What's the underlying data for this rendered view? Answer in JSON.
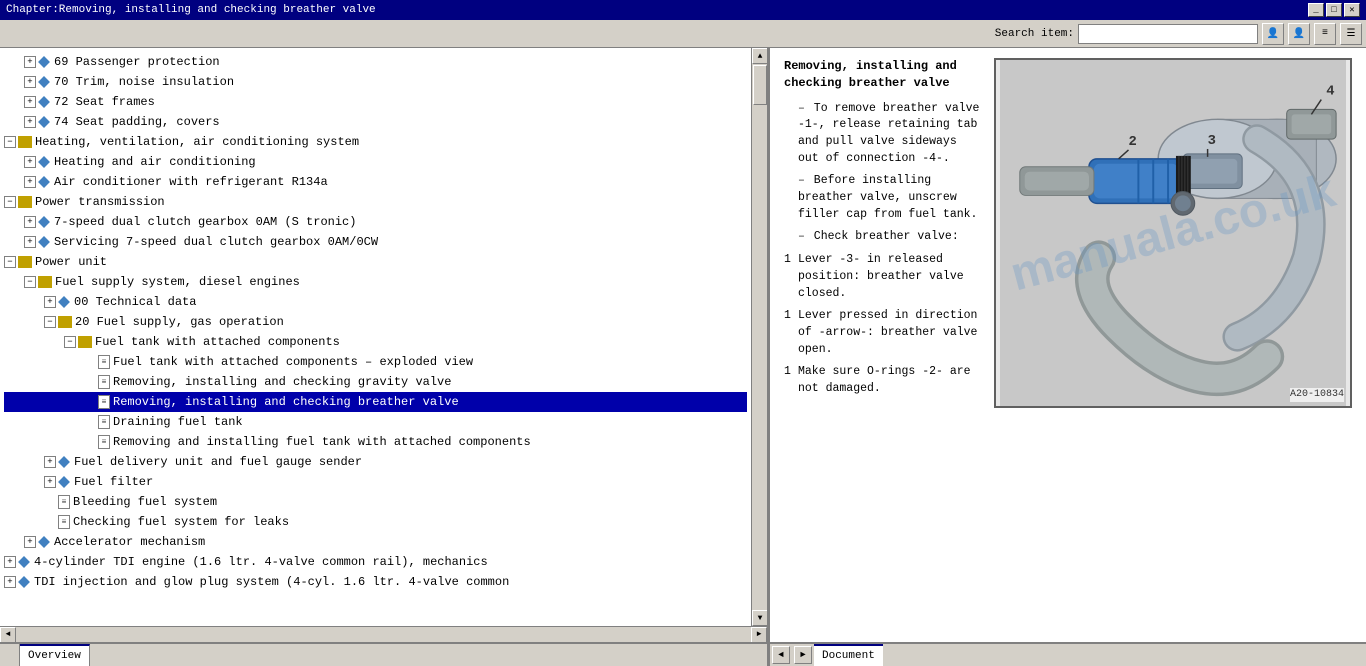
{
  "title_bar": {
    "text": "Chapter:Removing, installing and checking breather valve"
  },
  "toolbar": {
    "search_label": "Search item:",
    "search_placeholder": ""
  },
  "toolbar_buttons": [
    {
      "id": "user1",
      "label": "👤"
    },
    {
      "id": "user2",
      "label": "👤"
    },
    {
      "id": "menu1",
      "label": "≡"
    },
    {
      "id": "menu2",
      "label": "☰"
    }
  ],
  "tree": {
    "items": [
      {
        "level": 1,
        "type": "folder-expand",
        "text": "69  Passenger protection"
      },
      {
        "level": 1,
        "type": "folder-expand",
        "text": "70  Trim, noise insulation"
      },
      {
        "level": 1,
        "type": "folder-expand",
        "text": "72  Seat frames"
      },
      {
        "level": 1,
        "type": "folder-expand",
        "text": "74  Seat padding, covers"
      },
      {
        "level": 0,
        "type": "book-expand",
        "text": "Heating, ventilation, air conditioning system"
      },
      {
        "level": 1,
        "type": "diamond-expand",
        "text": "Heating and air conditioning"
      },
      {
        "level": 1,
        "type": "diamond-expand",
        "text": "Air conditioner with refrigerant R134a"
      },
      {
        "level": 0,
        "type": "book-expand",
        "text": "Power transmission"
      },
      {
        "level": 1,
        "type": "diamond-expand",
        "text": "7-speed dual clutch gearbox 0AM (S tronic)"
      },
      {
        "level": 1,
        "type": "diamond-expand",
        "text": "Servicing 7-speed dual clutch gearbox 0AM/0CW"
      },
      {
        "level": 0,
        "type": "book-expand",
        "text": "Power unit"
      },
      {
        "level": 1,
        "type": "book-expand",
        "text": "Fuel supply system, diesel engines"
      },
      {
        "level": 2,
        "type": "diamond-expand",
        "text": "00  Technical data"
      },
      {
        "level": 2,
        "type": "book-expand",
        "text": "20  Fuel supply, gas operation"
      },
      {
        "level": 3,
        "type": "book-expand",
        "text": "Fuel tank with attached components"
      },
      {
        "level": 4,
        "type": "doc",
        "text": "Fuel tank with attached components – exploded view"
      },
      {
        "level": 4,
        "type": "doc",
        "text": "Removing, installing and checking gravity valve"
      },
      {
        "level": 4,
        "type": "doc",
        "text": "Removing, installing and checking breather valve",
        "selected": true
      },
      {
        "level": 4,
        "type": "doc",
        "text": "Draining fuel tank"
      },
      {
        "level": 4,
        "type": "doc",
        "text": "Removing and installing fuel tank with attached components"
      },
      {
        "level": 2,
        "type": "diamond-expand",
        "text": "Fuel delivery unit and fuel gauge sender"
      },
      {
        "level": 2,
        "type": "diamond-expand",
        "text": "Fuel filter"
      },
      {
        "level": 2,
        "type": "doc",
        "text": "Bleeding fuel system"
      },
      {
        "level": 2,
        "type": "doc",
        "text": "Checking fuel system for leaks"
      },
      {
        "level": 1,
        "type": "diamond-expand",
        "text": "Accelerator mechanism"
      },
      {
        "level": 0,
        "type": "diamond-expand",
        "text": "4-cylinder TDI engine (1.6 ltr. 4-valve common rail), mechanics"
      },
      {
        "level": 0,
        "type": "diamond-expand",
        "text": "TDI injection and glow plug system (4-cyl. 1.6 ltr. 4-valve common"
      }
    ]
  },
  "document": {
    "title": "Removing, installing and\nchecking breather valve",
    "paragraphs": [
      {
        "num": "",
        "bullet": true,
        "text": "To remove breather valve -1-, release retaining tab and pull valve sideways out of connection -4-."
      },
      {
        "num": "",
        "bullet": true,
        "text": "Before installing breather valve, unscrew filler cap from fuel tank."
      },
      {
        "num": "",
        "bullet": true,
        "text": "Check breather valve:"
      },
      {
        "num": "1",
        "bullet": false,
        "text": "Lever -3- in released position: breather valve closed."
      },
      {
        "num": "1",
        "bullet": false,
        "text": "Lever pressed in direction of -arrow-: breather valve open."
      },
      {
        "num": "1",
        "bullet": false,
        "text": "Make sure O-rings -2- are not damaged."
      }
    ],
    "image_label": "A20-10834",
    "watermark": "manuala.co.uk"
  },
  "status_bar": {
    "left_tab": "Overview",
    "right_tabs": [
      "◄",
      "►",
      "Document"
    ]
  }
}
